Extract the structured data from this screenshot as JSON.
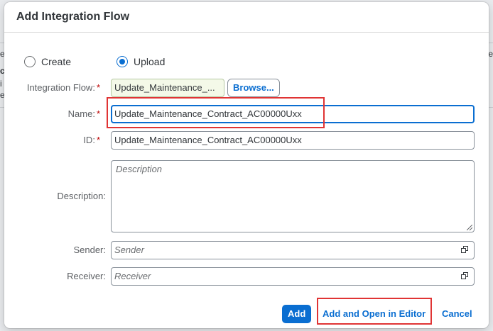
{
  "background": {
    "left_fragments": [
      "e",
      "ce",
      "i",
      "e"
    ],
    "right_fragments": [
      "e"
    ]
  },
  "dialog": {
    "title": "Add Integration Flow",
    "mode_options": [
      {
        "label": "Create",
        "selected": false
      },
      {
        "label": "Upload",
        "selected": true
      }
    ],
    "fields": {
      "integration_flow": {
        "label": "Integration Flow:",
        "required": "*",
        "value": "Update_Maintenance_..."
      },
      "browse_label": "Browse...",
      "name": {
        "label": "Name:",
        "required": "*",
        "value": "Update_Maintenance_Contract_AC00000Uxx"
      },
      "id": {
        "label": "ID:",
        "required": "*",
        "value": "Update_Maintenance_Contract_AC00000Uxx"
      },
      "description": {
        "label": "Description:",
        "placeholder": "Description"
      },
      "sender": {
        "label": "Sender:",
        "placeholder": "Sender",
        "icon": "value-help-icon"
      },
      "receiver": {
        "label": "Receiver:",
        "placeholder": "Receiver",
        "icon": "value-help-icon"
      }
    },
    "footer": {
      "add_label": "Add",
      "add_open_label": "Add and Open in Editor",
      "cancel_label": "Cancel"
    }
  },
  "colors": {
    "accent": "#0a6ed1",
    "required": "#bb0000",
    "highlight": "#e03434"
  }
}
